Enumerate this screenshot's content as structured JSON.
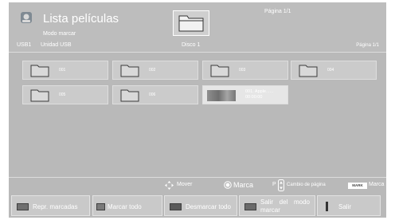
{
  "header": {
    "title": "Lista películas",
    "mode": "Modo marcar",
    "device_id": "USB1",
    "device_name": "Unidad USB",
    "disk": "Disco 1",
    "page_top": "Página 1/1",
    "page_right": "Página 1/1"
  },
  "grid": {
    "items": [
      {
        "label": "001",
        "type": "folder"
      },
      {
        "label": "002",
        "type": "folder"
      },
      {
        "label": "003",
        "type": "folder"
      },
      {
        "label": "004",
        "type": "folder"
      },
      {
        "label": "005",
        "type": "folder"
      },
      {
        "label": "006",
        "type": "folder"
      },
      {
        "label_line1": "001. Apple......",
        "label_line2": "00:00:00",
        "type": "video",
        "selected": true
      }
    ]
  },
  "hints": {
    "move": "Mover",
    "mark": "Marca",
    "page_change": "Cambio de página",
    "mark_key": "MARK",
    "mark2": "Marca"
  },
  "buttons": {
    "play_marked": "Repr. marcadas",
    "mark_all": "Marcar todo",
    "unmark_all": "Desmarcar todo",
    "exit_mark_mode": "Salir del modo marcar",
    "exit": "Salir"
  },
  "colors": {
    "screen_bg": "#b9b9b9",
    "item_bg": "#cbcbcb",
    "selected_bg": "#e6e6e6",
    "text": "#ffffff"
  }
}
